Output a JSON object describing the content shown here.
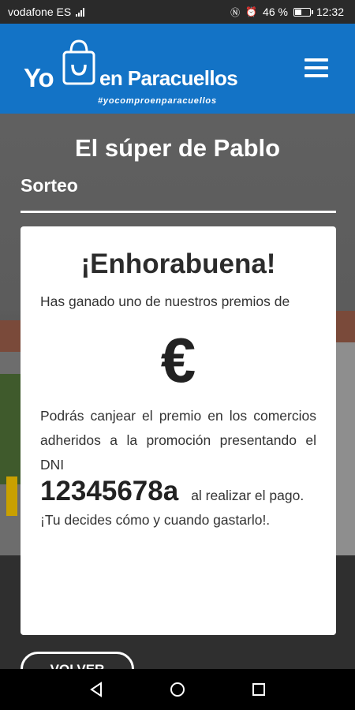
{
  "status_bar": {
    "carrier": "vodafone ES",
    "battery_percent": "46 %",
    "time": "12:32",
    "battery_level": 0.46
  },
  "header": {
    "logo_yo": "Yo",
    "logo_town": "en Paracuellos",
    "logo_tag": "#yocomproenparacuellos"
  },
  "page": {
    "title": "El súper de Pablo",
    "section": "Sorteo"
  },
  "card": {
    "heading": "¡Enhorabuena!",
    "won_text": "Has ganado uno de nuestros premios de",
    "currency": "€",
    "redeem_text": "Podrás canjear el premio en los comercios adheridos a la promoción presentando el DNI",
    "dni": "12345678a",
    "after_dni": "al realizar el pago.",
    "closing": "¡Tu decides cómo y cuando gastarlo!."
  },
  "buttons": {
    "back": "VOLVER"
  },
  "colors": {
    "header_bg": "#1373c6",
    "status_bg": "#2a2a2a",
    "nav_bg": "#000000"
  }
}
